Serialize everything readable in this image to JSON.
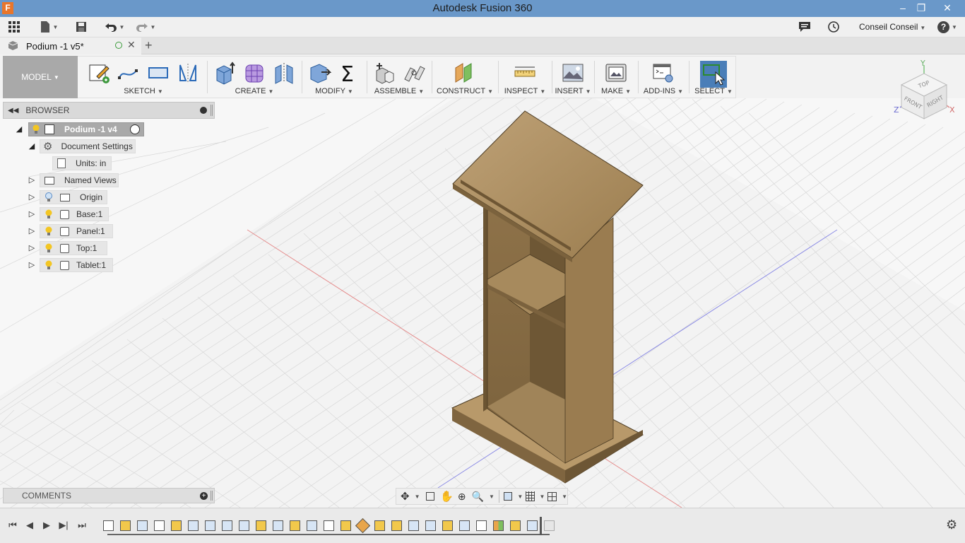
{
  "window": {
    "title": "Autodesk Fusion 360",
    "app_icon": "F",
    "minimize": "–",
    "restore": "❐",
    "close": "✕"
  },
  "qat": {
    "user": "Conseil Conseil",
    "help": "?"
  },
  "document_tab": {
    "label": "Podium -1 v5*",
    "new_tab": "+"
  },
  "toolbar": {
    "workspace": "MODEL",
    "groups": [
      {
        "label": "SKETCH"
      },
      {
        "label": "CREATE"
      },
      {
        "label": "MODIFY"
      },
      {
        "label": "ASSEMBLE"
      },
      {
        "label": "CONSTRUCT"
      },
      {
        "label": "INSPECT"
      },
      {
        "label": "INSERT"
      },
      {
        "label": "MAKE"
      },
      {
        "label": "ADD-INS"
      },
      {
        "label": "SELECT"
      }
    ]
  },
  "browser": {
    "title": "BROWSER",
    "root": "Podium -1 v4",
    "items": [
      {
        "label": "Document Settings"
      },
      {
        "label": "Units: in"
      },
      {
        "label": "Named Views"
      },
      {
        "label": "Origin"
      },
      {
        "label": "Base:1"
      },
      {
        "label": "Panel:1"
      },
      {
        "label": "Top:1"
      },
      {
        "label": "Tablet:1"
      }
    ]
  },
  "comments": {
    "title": "COMMENTS"
  },
  "viewcube": {
    "top": "TOP",
    "front": "FRONT",
    "right": "RIGHT",
    "x": "X",
    "y": "Y",
    "z": "Z"
  },
  "colors": {
    "titlebar": "#6a98c9",
    "wood": "#a88a5c",
    "x_axis": "#e06666",
    "z_axis": "#6666ee"
  }
}
